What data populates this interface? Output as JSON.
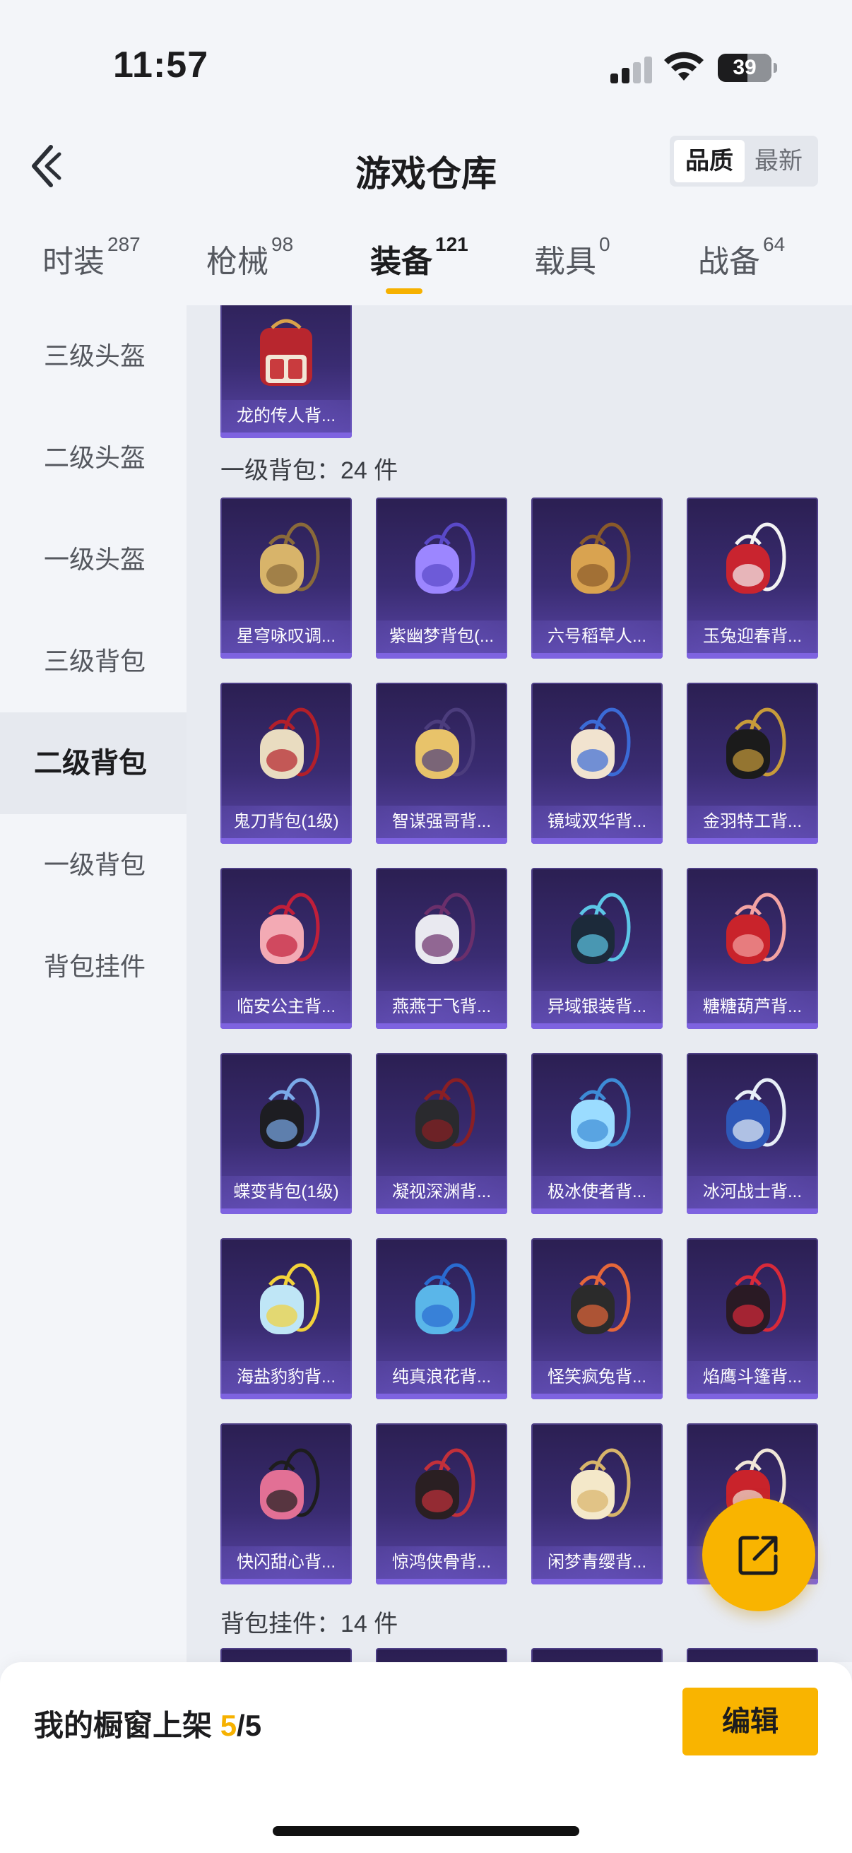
{
  "status_bar": {
    "time": "11:57",
    "battery": "39"
  },
  "header": {
    "title": "游戏仓库",
    "sort_quality": "品质",
    "sort_latest": "最新"
  },
  "tabs": [
    {
      "label": "时装",
      "count": "287",
      "active": false
    },
    {
      "label": "枪械",
      "count": "98",
      "active": false
    },
    {
      "label": "装备",
      "count": "121",
      "active": true
    },
    {
      "label": "载具",
      "count": "0",
      "active": false
    },
    {
      "label": "战备",
      "count": "64",
      "active": false
    }
  ],
  "sidebar": {
    "items": [
      {
        "label": "三级头盔",
        "active": false
      },
      {
        "label": "二级头盔",
        "active": false
      },
      {
        "label": "一级头盔",
        "active": false
      },
      {
        "label": "三级背包",
        "active": false
      },
      {
        "label": "二级背包",
        "active": true
      },
      {
        "label": "一级背包",
        "active": false
      },
      {
        "label": "背包挂件",
        "active": false
      }
    ]
  },
  "content": {
    "top_item": {
      "name": "龙的传人背...",
      "icon": "red-backpack-icon"
    },
    "section_1": {
      "label": "一级背包：24 件"
    },
    "items": [
      {
        "name": "星穹咏叹调...",
        "icon": "gold-sling-bag-icon"
      },
      {
        "name": "紫幽梦背包(...",
        "icon": "purple-orb-bag-icon"
      },
      {
        "name": "六号稻草人...",
        "icon": "scarecrow-bag-icon"
      },
      {
        "name": "玉兔迎春背...",
        "icon": "red-backpack-icon"
      },
      {
        "name": "鬼刀背包(1级)",
        "icon": "white-sling-bag-icon"
      },
      {
        "name": "智谋强哥背...",
        "icon": "face-bag-icon"
      },
      {
        "name": "镜域双华背...",
        "icon": "heart-bag-icon"
      },
      {
        "name": "金羽特工背...",
        "icon": "black-backpack-icon"
      },
      {
        "name": "临安公主背...",
        "icon": "flower-bag-icon"
      },
      {
        "name": "燕燕于飞背...",
        "icon": "fan-bag-icon"
      },
      {
        "name": "异域银装背...",
        "icon": "dark-pouch-icon"
      },
      {
        "name": "糖糖葫芦背...",
        "icon": "red-round-bag-icon"
      },
      {
        "name": "蝶变背包(1级)",
        "icon": "butterfly-bag-icon"
      },
      {
        "name": "凝视深渊背...",
        "icon": "abyss-backpack-icon"
      },
      {
        "name": "极冰使者背...",
        "icon": "ice-crystal-bag-icon"
      },
      {
        "name": "冰河战士背...",
        "icon": "blue-backpack-icon"
      },
      {
        "name": "海盐豹豹背...",
        "icon": "seal-plush-bag-icon"
      },
      {
        "name": "纯真浪花背...",
        "icon": "wave-cup-bag-icon"
      },
      {
        "name": "怪笑疯兔背...",
        "icon": "rabbit-mask-bag-icon"
      },
      {
        "name": "焰鹰斗篷背...",
        "icon": "eagle-cape-bag-icon"
      },
      {
        "name": "快闪甜心背...",
        "icon": "pink-camera-bag-icon"
      },
      {
        "name": "惊鸿侠骨背...",
        "icon": "black-red-backpack-icon"
      },
      {
        "name": "闲梦青缨背...",
        "icon": "shell-bag-icon"
      },
      {
        "name": "",
        "icon": "red-white-backpack-icon"
      }
    ],
    "section_2": {
      "label": "背包挂件：14 件"
    }
  },
  "bottom_bar": {
    "shelf_label": "我的橱窗上架",
    "shelf_current": "5",
    "shelf_total": "/5",
    "edit_label": "编辑"
  },
  "colors": {
    "accent": "#f6b100",
    "card_top": "#2b1f52",
    "card_bottom": "#5a46a8"
  }
}
